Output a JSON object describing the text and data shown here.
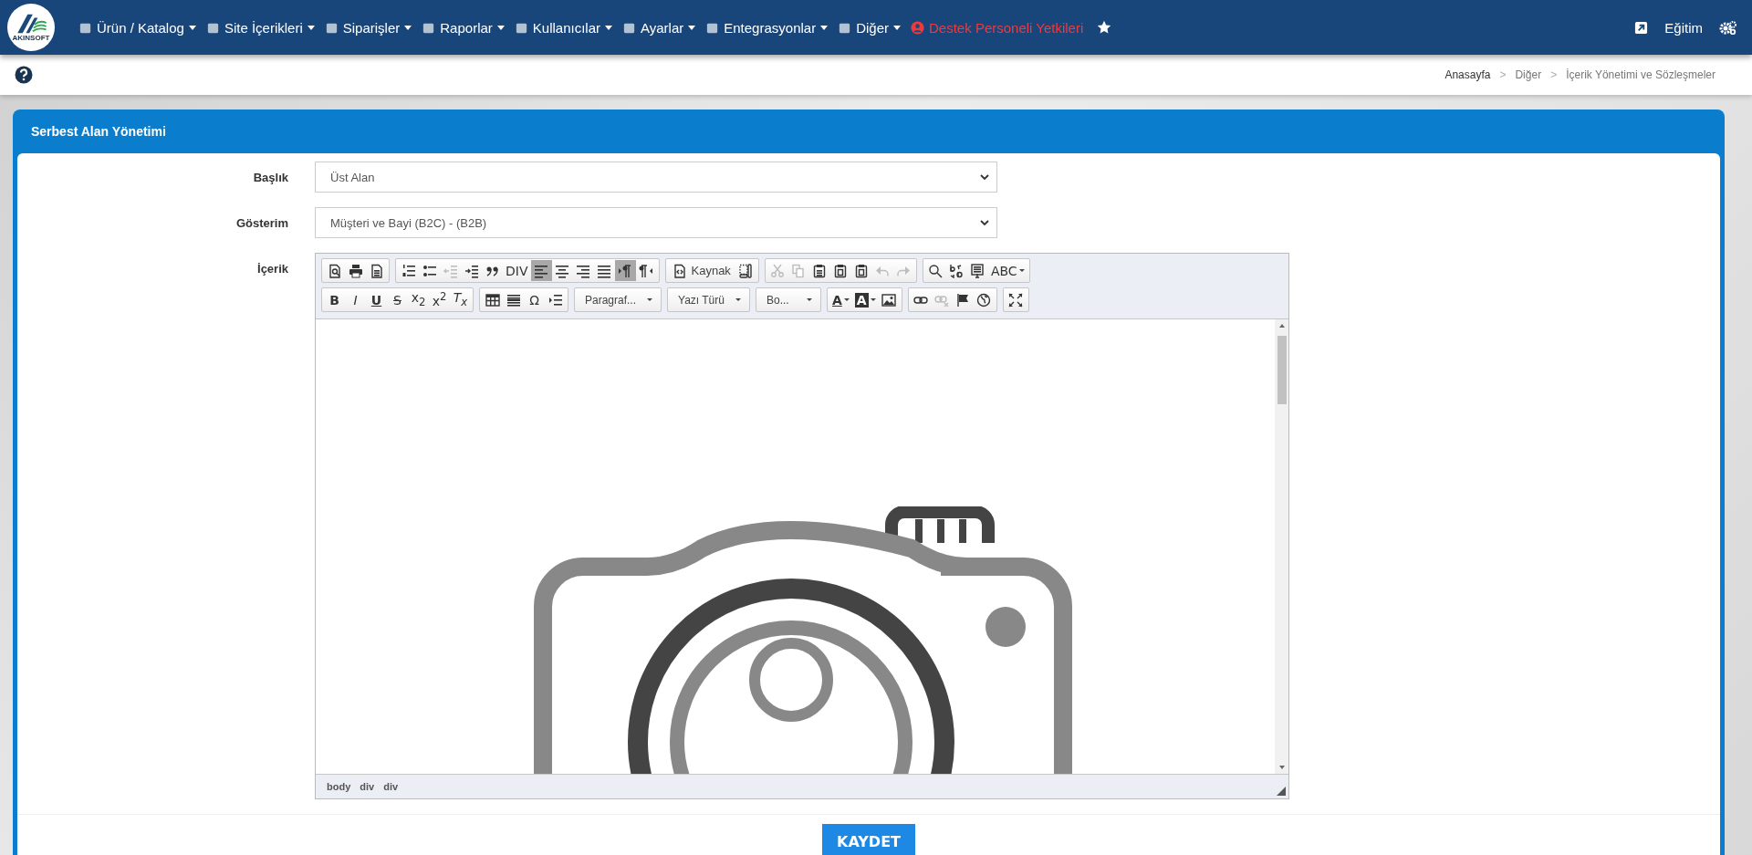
{
  "nav": {
    "logo_text": "AKINSOFT",
    "items": [
      {
        "label": "Ürün / Katalog",
        "dropdown": true,
        "highlighted": false
      },
      {
        "label": "Site İçerikleri",
        "dropdown": true,
        "highlighted": false
      },
      {
        "label": "Siparişler",
        "dropdown": true,
        "highlighted": false
      },
      {
        "label": "Raporlar",
        "dropdown": true,
        "highlighted": false
      },
      {
        "label": "Kullanıcılar",
        "dropdown": true,
        "highlighted": false
      },
      {
        "label": "Ayarlar",
        "dropdown": true,
        "highlighted": false
      },
      {
        "label": "Entegrasyonlar",
        "dropdown": true,
        "highlighted": false
      },
      {
        "label": "Diğer",
        "dropdown": true,
        "highlighted": false
      },
      {
        "label": "Destek Personeli Yetkileri",
        "dropdown": false,
        "highlighted": true
      }
    ],
    "right_label": "Eğitim"
  },
  "breadcrumb": {
    "separator": ">",
    "items": [
      "Anasayfa",
      "Diğer",
      "İçerik Yönetimi ve Sözleşmeler"
    ]
  },
  "panel": {
    "title": "Serbest Alan Yönetimi",
    "fields": [
      {
        "label": "Başlık",
        "value": "Üst Alan"
      },
      {
        "label": "Gösterim",
        "value": "Müşteri ve Bayi (B2C) - (B2B)"
      }
    ],
    "editor_label": "İçerik",
    "toolbar": [
      [
        {
          "buttons": [
            {
              "kind": "icon",
              "active": false,
              "disabled": false
            },
            {
              "kind": "icon",
              "active": false,
              "disabled": false
            },
            {
              "kind": "icon",
              "active": false,
              "disabled": false
            }
          ]
        },
        {
          "buttons": [
            {
              "kind": "icon",
              "active": false,
              "disabled": false
            },
            {
              "kind": "icon",
              "active": false,
              "disabled": false
            },
            {
              "kind": "icon",
              "active": false,
              "disabled": true
            },
            {
              "kind": "icon",
              "active": false,
              "disabled": false
            },
            {
              "kind": "icon",
              "active": false,
              "disabled": false
            },
            {
              "kind": "glyph",
              "label": "DIV",
              "active": false,
              "disabled": false
            },
            {
              "kind": "icon",
              "active": true,
              "disabled": false
            },
            {
              "kind": "icon",
              "active": false,
              "disabled": false
            },
            {
              "kind": "icon",
              "active": false,
              "disabled": false
            },
            {
              "kind": "icon",
              "active": false,
              "disabled": false
            },
            {
              "kind": "icon",
              "active": true,
              "disabled": false
            },
            {
              "kind": "icon",
              "active": false,
              "disabled": false
            }
          ]
        },
        {
          "buttons": [
            {
              "kind": "text",
              "label": "Kaynak",
              "active": false,
              "disabled": false
            },
            {
              "kind": "icon",
              "active": false,
              "disabled": false
            }
          ]
        },
        {
          "buttons": [
            {
              "kind": "icon",
              "active": false,
              "disabled": true
            },
            {
              "kind": "icon",
              "active": false,
              "disabled": true
            },
            {
              "kind": "icon",
              "active": false,
              "disabled": false
            },
            {
              "kind": "icon",
              "active": false,
              "disabled": false
            },
            {
              "kind": "icon",
              "active": false,
              "disabled": false
            },
            {
              "kind": "icon",
              "active": false,
              "disabled": true
            },
            {
              "kind": "icon",
              "active": false,
              "disabled": true
            }
          ]
        },
        {
          "buttons": [
            {
              "kind": "icon",
              "active": false,
              "disabled": false
            },
            {
              "kind": "icon",
              "active": false,
              "disabled": false
            },
            {
              "kind": "icon",
              "active": false,
              "disabled": false
            },
            {
              "kind": "glyph",
              "label": "ABC",
              "active": false,
              "disabled": false
            }
          ]
        }
      ],
      [
        {
          "buttons": [
            {
              "kind": "glyph",
              "label": "B",
              "active": false,
              "disabled": false
            },
            {
              "kind": "glyph",
              "label": "I",
              "active": false,
              "disabled": false
            },
            {
              "kind": "glyph",
              "label": "U",
              "active": false,
              "disabled": false
            },
            {
              "kind": "glyph",
              "label": "S",
              "active": false,
              "disabled": false
            },
            {
              "kind": "glyph",
              "label": "x$_{2}$",
              "active": false,
              "disabled": false
            },
            {
              "kind": "glyph",
              "label": "x$^{2}$",
              "active": false,
              "disabled": false
            },
            {
              "kind": "glyph",
              "label": "T$_{x}$",
              "active": false,
              "disabled": false
            }
          ]
        },
        {
          "buttons": [
            {
              "kind": "icon",
              "active": false,
              "disabled": false
            },
            {
              "kind": "icon",
              "active": false,
              "disabled": false
            },
            {
              "kind": "glyph",
              "label": "Ω",
              "active": false,
              "disabled": false
            },
            {
              "kind": "icon",
              "active": false,
              "disabled": false
            }
          ]
        },
        {
          "buttons": [
            {
              "kind": "combo",
              "label": "Paragraf..."
            }
          ]
        },
        {
          "buttons": [
            {
              "kind": "combo",
              "label": "Yazı Türü"
            }
          ]
        },
        {
          "buttons": [
            {
              "kind": "combo",
              "label": "Bo..."
            }
          ]
        },
        {
          "buttons": [
            {
              "kind": "glyph",
              "label": "A",
              "active": false,
              "disabled": false
            },
            {
              "kind": "glyph",
              "label": "A",
              "active": false,
              "disabled": false
            },
            {
              "kind": "icon",
              "active": false,
              "disabled": false
            }
          ]
        },
        {
          "buttons": [
            {
              "kind": "icon",
              "active": false,
              "disabled": false
            },
            {
              "kind": "icon",
              "active": false,
              "disabled": true
            },
            {
              "kind": "icon",
              "active": false,
              "disabled": false
            },
            {
              "kind": "icon",
              "active": false,
              "disabled": false
            }
          ]
        },
        {
          "buttons": [
            {
              "kind": "icon",
              "active": false,
              "disabled": false
            }
          ]
        }
      ]
    ],
    "path": [
      "body",
      "div",
      "div"
    ],
    "save_button": "KAYDET"
  }
}
